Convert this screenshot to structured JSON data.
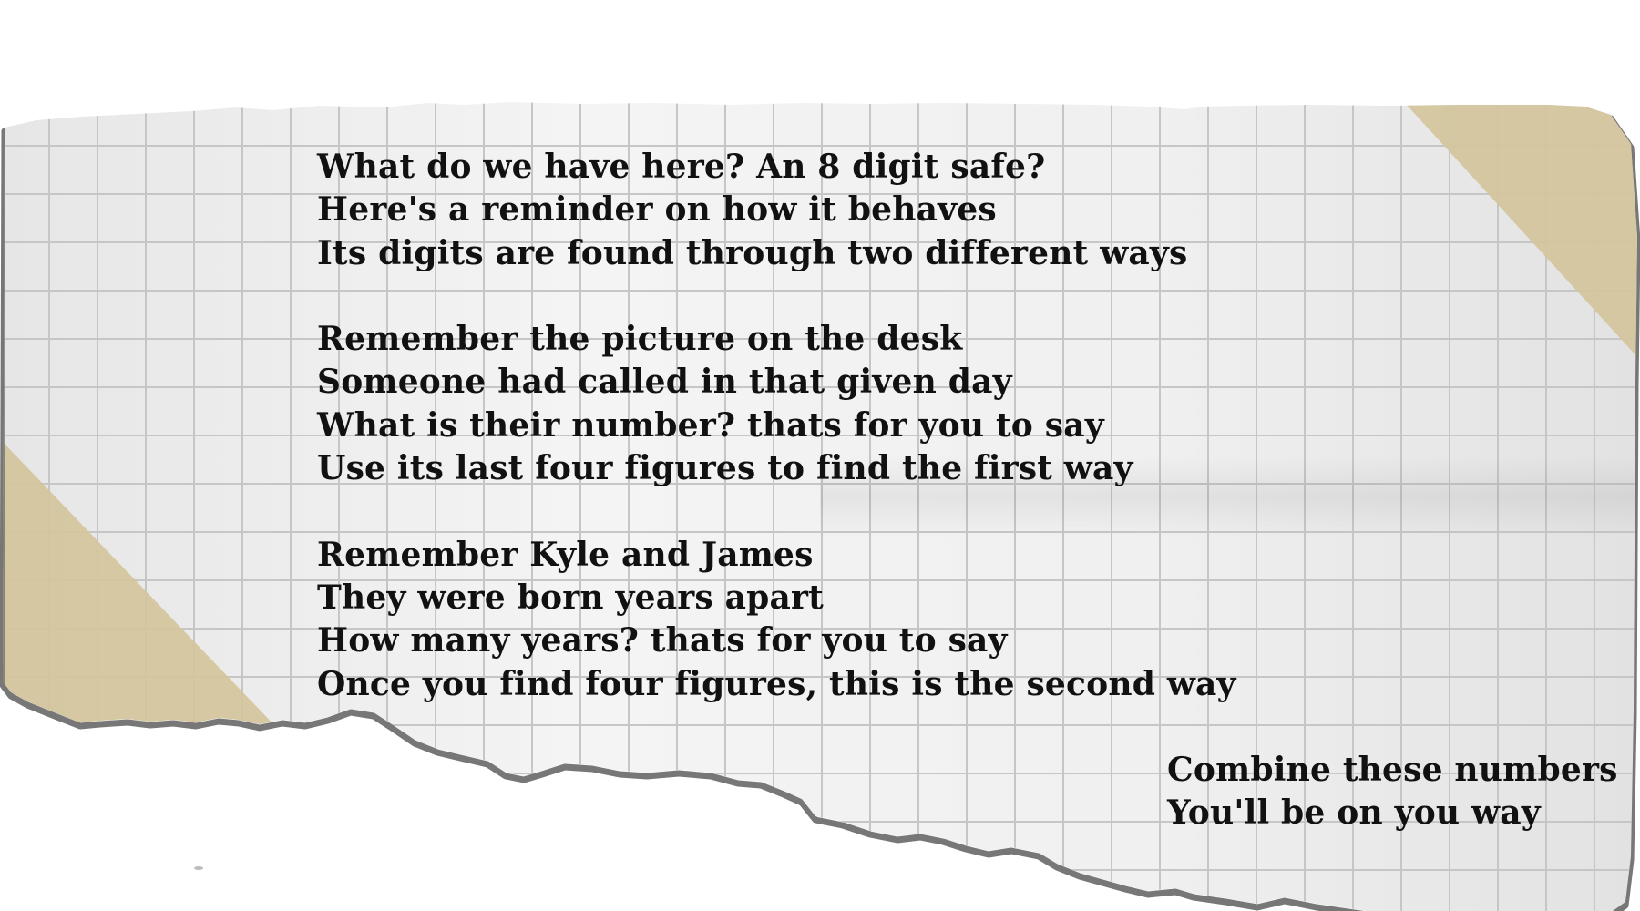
{
  "note": {
    "stanzas": [
      {
        "lines": [
          "What do we have here? An 8 digit safe?",
          "Here's a reminder on how it behaves",
          "Its digits are found through two different ways"
        ]
      },
      {
        "lines": [
          "Remember the picture on the desk",
          "Someone had called in that given day",
          "What is their number? thats for you to say",
          "Use its last four figures to find the first way"
        ]
      },
      {
        "lines": [
          "Remember Kyle and James",
          "They were born years apart",
          "How many years? thats for you to say",
          "Once you find four figures, this is the second way"
        ]
      }
    ],
    "closing": [
      "Combine these numbers",
      "You'll be on you way"
    ]
  },
  "colors": {
    "paper": "#f1f1f1",
    "grid_line": "#c9c9c9",
    "tape": "#d3c49b",
    "text": "#111111",
    "torn_edge_shadow": "#555555"
  }
}
